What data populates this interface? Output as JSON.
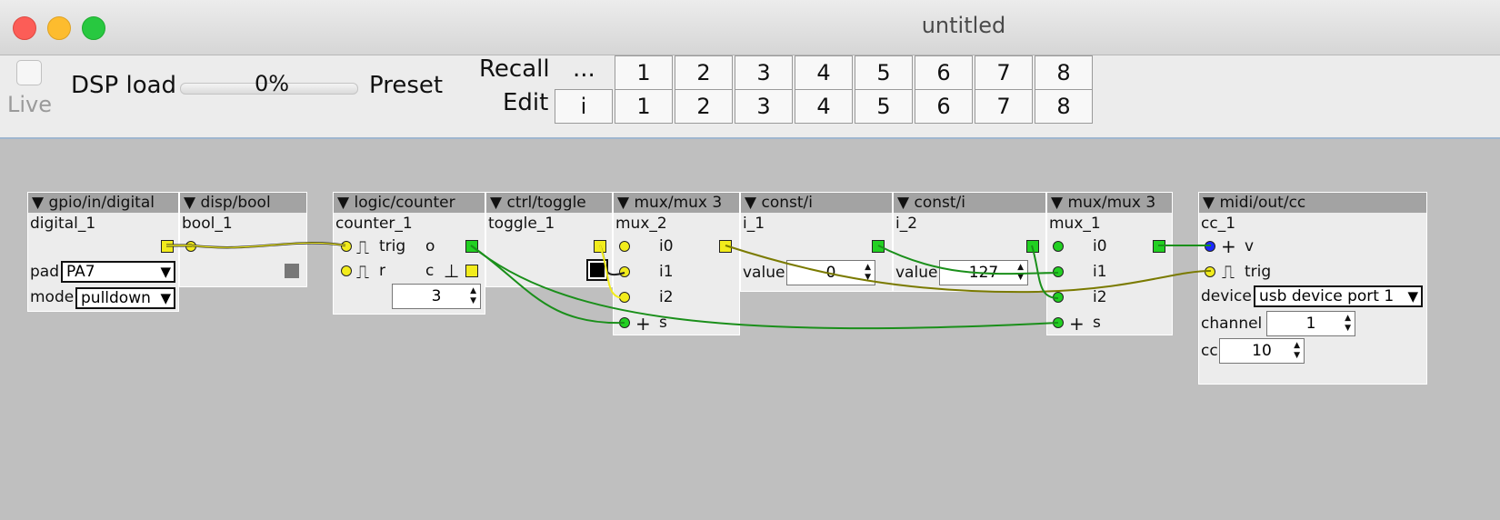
{
  "window": {
    "title": "untitled"
  },
  "toolbar": {
    "live_label": "Live",
    "dsp_label": "DSP load",
    "dsp_percent": "0%",
    "dsp_value": 0,
    "preset_label": "Preset",
    "recall_label": "Recall",
    "recall_more": "...",
    "edit_label": "Edit",
    "edit_init": "i",
    "presets": [
      "1",
      "2",
      "3",
      "4",
      "5",
      "6",
      "7",
      "8"
    ]
  },
  "colors": {
    "bool": "#f2ec1c",
    "int": "#22d022",
    "frac": "#1a2aff",
    "canvas": "#bfbfbf",
    "header": "#a3a3a3"
  },
  "objects": {
    "gpio": {
      "type": "▼ gpio/in/digital",
      "name": "digital_1",
      "pad_label": "pad",
      "pad_value": "PA7",
      "mode_label": "mode",
      "mode_value": "pulldown",
      "arrow": "▼"
    },
    "bool": {
      "type": "▼ disp/bool",
      "name": "bool_1"
    },
    "counter": {
      "type": "▼ logic/counter",
      "name": "counter_1",
      "in_trig": "trig",
      "in_r": "r",
      "out_o": "o",
      "out_c": "c",
      "value": "3",
      "trig_glyph": "⎍",
      "c_glyph": "⊥"
    },
    "toggle": {
      "type": "▼ ctrl/toggle",
      "name": "toggle_1"
    },
    "mux2": {
      "type": "▼ mux/mux 3",
      "name": "mux_2",
      "inputs": [
        "i0",
        "i1",
        "i2"
      ],
      "s_label": "s",
      "plus": "+"
    },
    "const1": {
      "type": "▼ const/i",
      "name": "i_1",
      "value_label": "value",
      "value": "0"
    },
    "const2": {
      "type": "▼ const/i",
      "name": "i_2",
      "value_label": "value",
      "value": "127"
    },
    "mux1": {
      "type": "▼ mux/mux 3",
      "name": "mux_1",
      "inputs": [
        "i0",
        "i1",
        "i2"
      ],
      "s_label": "s",
      "plus": "+"
    },
    "midi": {
      "type": "▼ midi/out/cc",
      "name": "cc_1",
      "in_v": "v",
      "in_trig": "trig",
      "plus": "+",
      "device_label": "device",
      "device_value": "usb device port 1",
      "arrow": "▼",
      "channel_label": "channel",
      "channel_value": "1",
      "cc_label": "cc",
      "cc_value": "10"
    }
  }
}
